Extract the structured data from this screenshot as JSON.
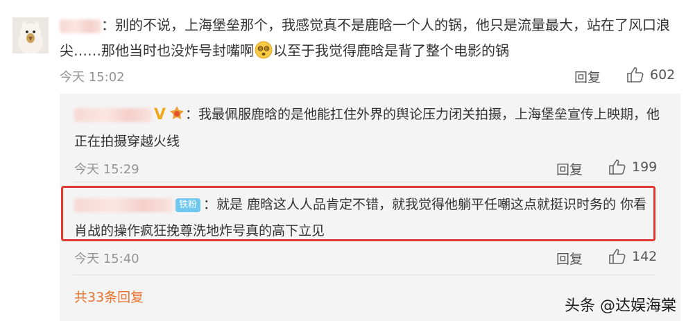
{
  "main_comment": {
    "text": "：别的不说，上海堡垒那个，我感觉真不是鹿晗一个人的锅，他只是流量最大，站在了风口浪尖……那他当时也没炸号封嘴啊",
    "text_after_emoji": "以至于我觉得鹿晗是背了整个电影的锅",
    "timestamp": "今天 15:02",
    "reply_label": "回复",
    "likes": "602"
  },
  "replies": [
    {
      "text": "：我最佩服鹿晗的是他能扛住外界的舆论压力闭关拍摄，上海堡垒宣传上映期，他正在拍摄穿越火线",
      "verified_mark": "V",
      "timestamp": "今天 15:29",
      "reply_label": "回复",
      "likes": "199"
    },
    {
      "badge": "铁粉",
      "text": "：就是  鹿晗这人人品肯定不错，就我觉得他躺平任嘲这点就挺识时务的  你看肖战的操作疯狂挽尊洗地炸号真的高下立见",
      "timestamp": "今天 15:40",
      "reply_label": "回复",
      "likes": "142"
    }
  ],
  "more_replies": "共33条回复",
  "watermark": "头条 @达娱海棠"
}
